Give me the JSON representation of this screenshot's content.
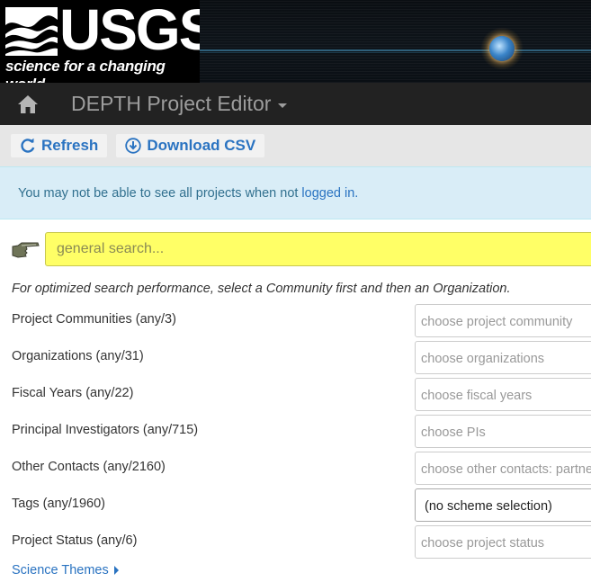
{
  "banner": {
    "wordmark": "USGS",
    "tagline": "science for a changing world"
  },
  "navbar": {
    "home_icon": "home-icon",
    "brand": "DEPTH Project Editor"
  },
  "toolbar": {
    "refresh_label": "Refresh",
    "refresh_icon": "refresh-icon",
    "download_label": "Download CSV",
    "download_icon": "download-icon"
  },
  "alert": {
    "message": "You may not be able to see all projects when not",
    "link": "logged in."
  },
  "search": {
    "placeholder": "general search..."
  },
  "hint": "For optimized search performance, select a Community first and then an Organization.",
  "filters": [
    {
      "label": "Project Communities (any/3)",
      "placeholder": "choose project community"
    },
    {
      "label": "Organizations (any/31)",
      "placeholder": "choose organizations"
    },
    {
      "label": "Fiscal Years (any/22)",
      "placeholder": "choose fiscal years"
    },
    {
      "label": "Principal Investigators (any/715)",
      "placeholder": "choose PIs"
    },
    {
      "label": "Other Contacts (any/2160)",
      "placeholder": "choose other contacts: partne"
    },
    {
      "label": "Tags (any/1960)",
      "value": "(no scheme selection)"
    },
    {
      "label": "Project Status (any/6)",
      "placeholder": "choose project status"
    }
  ],
  "science_themes": "Science Themes",
  "colors": {
    "navbar": "#222222",
    "accent": "#2a73c1",
    "search_bg": "#ffff66",
    "alert_bg": "#d9edf7"
  }
}
